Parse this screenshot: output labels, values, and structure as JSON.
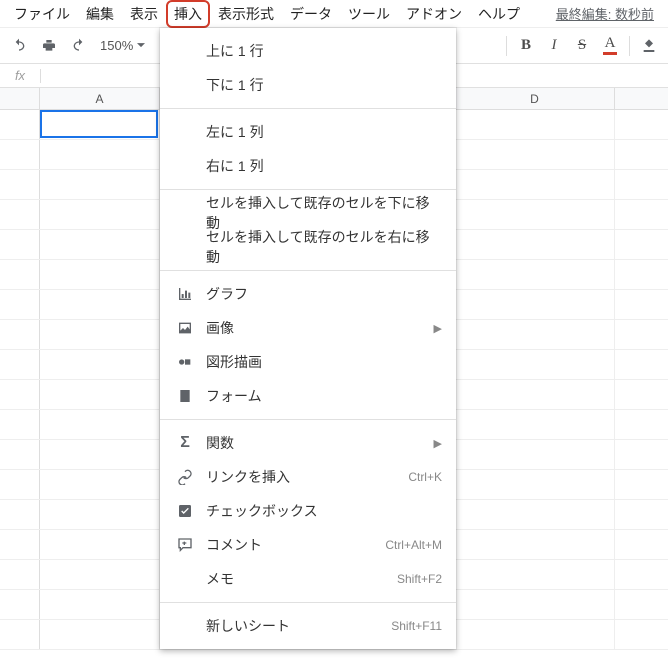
{
  "menubar": {
    "items": [
      "ファイル",
      "編集",
      "表示",
      "挿入",
      "表示形式",
      "データ",
      "ツール",
      "アドオン",
      "ヘルプ"
    ],
    "active_index": 3,
    "last_edit": "最終編集: 数秒前"
  },
  "toolbar": {
    "zoom": "150%",
    "bold": "B",
    "italic": "I",
    "strike": "S",
    "textcolor": "A"
  },
  "formula_bar": {
    "fx": "fx"
  },
  "columns": {
    "A": "A",
    "D": "D"
  },
  "dropdown": {
    "group1": [
      {
        "label": "上に 1 行"
      },
      {
        "label": "下に 1 行"
      }
    ],
    "group2": [
      {
        "label": "左に 1 列"
      },
      {
        "label": "右に 1 列"
      }
    ],
    "group3": [
      {
        "label": "セルを挿入して既存のセルを下に移動"
      },
      {
        "label": "セルを挿入して既存のセルを右に移動"
      }
    ],
    "group4": [
      {
        "icon": "chart",
        "label": "グラフ"
      },
      {
        "icon": "image",
        "label": "画像",
        "submenu": true
      },
      {
        "icon": "drawing",
        "label": "図形描画"
      },
      {
        "icon": "form",
        "label": "フォーム"
      }
    ],
    "group5": [
      {
        "icon": "sigma",
        "label": "関数",
        "submenu": true
      },
      {
        "icon": "link",
        "label": "リンクを挿入",
        "shortcut": "Ctrl+K"
      },
      {
        "icon": "checkbox",
        "label": "チェックボックス"
      },
      {
        "icon": "comment",
        "label": "コメント",
        "shortcut": "Ctrl+Alt+M"
      },
      {
        "icon": "",
        "label": "メモ",
        "shortcut": "Shift+F2"
      }
    ],
    "group6": [
      {
        "label": "新しいシート",
        "shortcut": "Shift+F11"
      }
    ]
  },
  "peek_chars": [
    ")",
    ")",
    ")",
    ")",
    ")"
  ]
}
